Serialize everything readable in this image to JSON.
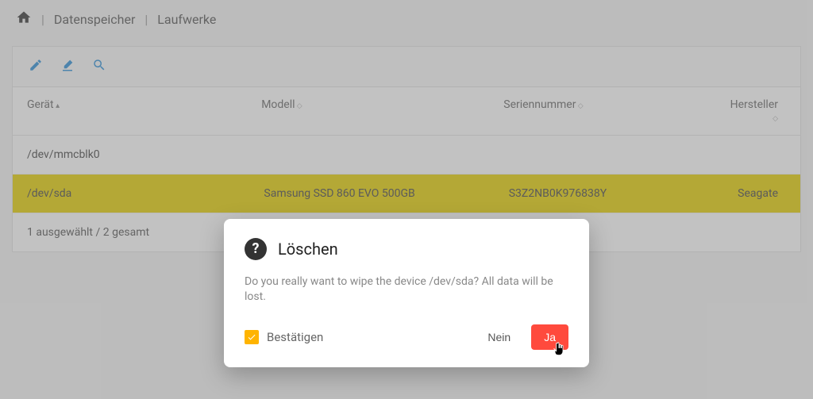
{
  "breadcrumb": {
    "item1": "Datenspeicher",
    "item2": "Laufwerke"
  },
  "table": {
    "headers": {
      "device": "Gerät",
      "model": "Modell",
      "serial": "Seriennummer",
      "manufacturer": "Hersteller"
    },
    "rows": [
      {
        "device": "/dev/mmcblk0",
        "model": "",
        "serial": "",
        "manufacturer": ""
      },
      {
        "device": "/dev/sda",
        "model": "Samsung SSD 860 EVO 500GB",
        "serial": "S3Z2NB0K976838Y",
        "manufacturer": "Seagate"
      }
    ],
    "footer": "1 ausgewählt / 2 gesamt"
  },
  "dialog": {
    "title": "Löschen",
    "message": "Do you really want to wipe the device /dev/sda? All data will be lost.",
    "confirm_label": "Bestätigen",
    "no_label": "Nein",
    "yes_label": "Ja"
  }
}
